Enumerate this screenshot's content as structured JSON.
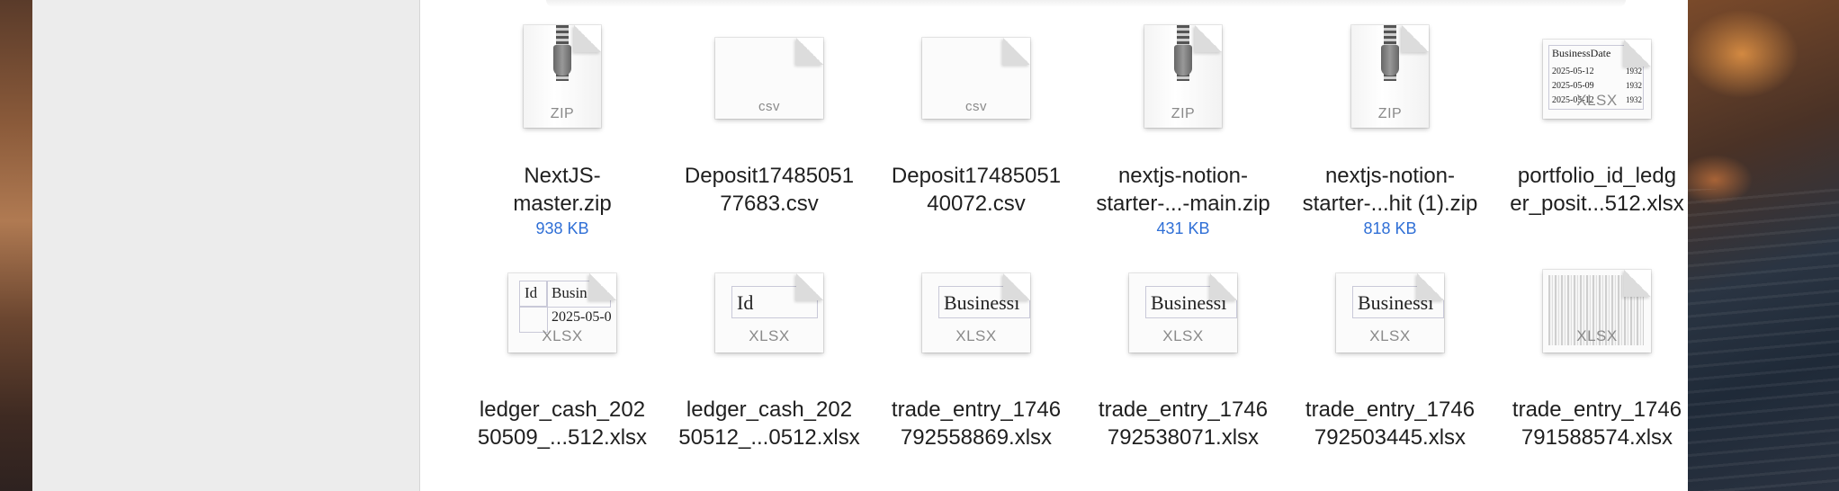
{
  "window": {
    "sidebar": {},
    "content": {}
  },
  "colors": {
    "size_text": "#2f6fd6",
    "file_name": "#1f1f1f",
    "type_label": "#8a8a8a"
  },
  "files": [
    {
      "type": "zip",
      "type_label": "ZIP",
      "name_line1": "NextJS-",
      "name_line2": "master.zip",
      "size": "938 KB"
    },
    {
      "type": "csv",
      "type_label": "csv",
      "name_line1": "Deposit17485051",
      "name_line2": "77683.csv",
      "size": ""
    },
    {
      "type": "csv",
      "type_label": "csv",
      "name_line1": "Deposit17485051",
      "name_line2": "40072.csv",
      "size": ""
    },
    {
      "type": "zip",
      "type_label": "ZIP",
      "name_line1": "nextjs-notion-",
      "name_line2": "starter-...-main.zip",
      "size": "431 KB"
    },
    {
      "type": "zip",
      "type_label": "ZIP",
      "name_line1": "nextjs-notion-",
      "name_line2": "starter-...hit (1).zip",
      "size": "818 KB"
    },
    {
      "type": "xlsx",
      "type_label": "XLSX",
      "name_line1": "portfolio_id_ledg",
      "name_line2": "er_posit...512.xlsx",
      "size": "",
      "preview": {
        "header": "BusinessDate",
        "rows": [
          "2025-05-12",
          "2025-05-09",
          "2025-05-12"
        ],
        "col2": "1932"
      }
    },
    {
      "type": "xlsx",
      "type_label": "XLSX",
      "name_line1": "ledger_cash_202",
      "name_line2": "50509_...512.xlsx",
      "size": "",
      "preview": {
        "c1": "Id",
        "c2": "Busin",
        "r1": "2025-05-0"
      }
    },
    {
      "type": "xlsx",
      "type_label": "XLSX",
      "name_line1": "ledger_cash_202",
      "name_line2": "50512_...0512.xlsx",
      "size": "",
      "preview": {
        "c1": "Id"
      }
    },
    {
      "type": "xlsx",
      "type_label": "XLSX",
      "name_line1": "trade_entry_1746",
      "name_line2": "792558869.xlsx",
      "size": "",
      "preview": {
        "c1": "Businessı"
      }
    },
    {
      "type": "xlsx",
      "type_label": "XLSX",
      "name_line1": "trade_entry_1746",
      "name_line2": "792538071.xlsx",
      "size": "",
      "preview": {
        "c1": "Businessı"
      }
    },
    {
      "type": "xlsx",
      "type_label": "XLSX",
      "name_line1": "trade_entry_1746",
      "name_line2": "792503445.xlsx",
      "size": "",
      "preview": {
        "c1": "Businessı"
      }
    },
    {
      "type": "xlsx",
      "type_label": "XLSX",
      "name_line1": "trade_entry_1746",
      "name_line2": "791588574.xlsx",
      "size": ""
    }
  ]
}
